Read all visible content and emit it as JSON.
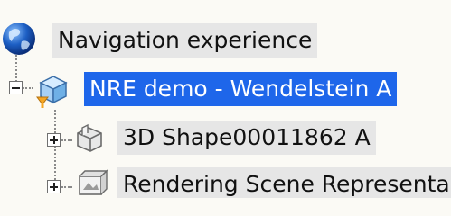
{
  "tree": {
    "root": {
      "label": "Navigation experience"
    },
    "selected_node": {
      "label": "NRE demo - Wendelstein A"
    },
    "children": [
      {
        "label": "3D Shape00011862 A"
      },
      {
        "label": "Rendering Scene Representa"
      }
    ]
  },
  "colors": {
    "selection": "#1e66ea",
    "row_highlight": "#e6e6e6",
    "background": "#fbfaf5"
  },
  "icons": {
    "root": "globe-icon",
    "node": "product-cube-icon",
    "child_1": "3d-shape-icon",
    "child_2": "rendering-scene-icon"
  }
}
